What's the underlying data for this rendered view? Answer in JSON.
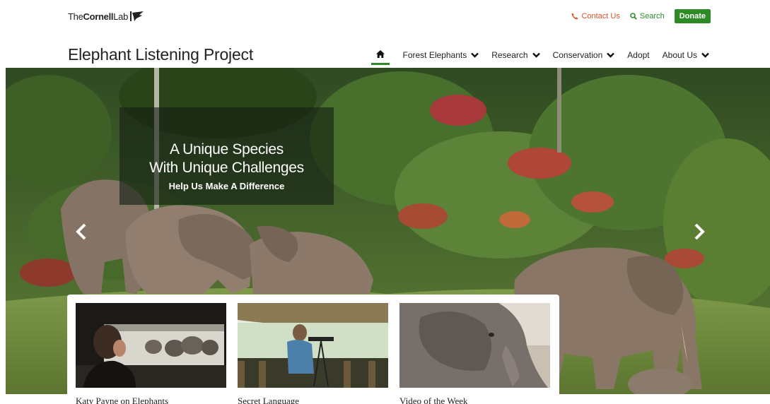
{
  "logo": {
    "the": "The",
    "cornell": "Cornell",
    "lab": "Lab"
  },
  "utility": {
    "contact": "Contact Us",
    "search": "Search",
    "donate": "Donate"
  },
  "site_title": "Elephant Listening Project",
  "nav": {
    "items": [
      {
        "label": "Forest Elephants",
        "dropdown": true
      },
      {
        "label": "Research",
        "dropdown": true
      },
      {
        "label": "Conservation",
        "dropdown": true
      },
      {
        "label": "Adopt",
        "dropdown": false
      },
      {
        "label": "About Us",
        "dropdown": true
      }
    ]
  },
  "hero": {
    "title_line1": "A Unique Species",
    "title_line2": "With Unique Challenges",
    "subtitle": "Help Us Make A Difference"
  },
  "cards": [
    {
      "title": "Katy Payne on Elephants"
    },
    {
      "title": "Secret Language"
    },
    {
      "title": "Video of the Week"
    }
  ],
  "colors": {
    "accent_green": "#2d8a26",
    "contact_orange": "#d9542a"
  },
  "icons": {
    "home": "home-icon",
    "phone": "phone-icon",
    "search": "search-icon",
    "chevron": "chevron-down-icon",
    "prev": "chevron-left-icon",
    "next": "chevron-right-icon"
  }
}
